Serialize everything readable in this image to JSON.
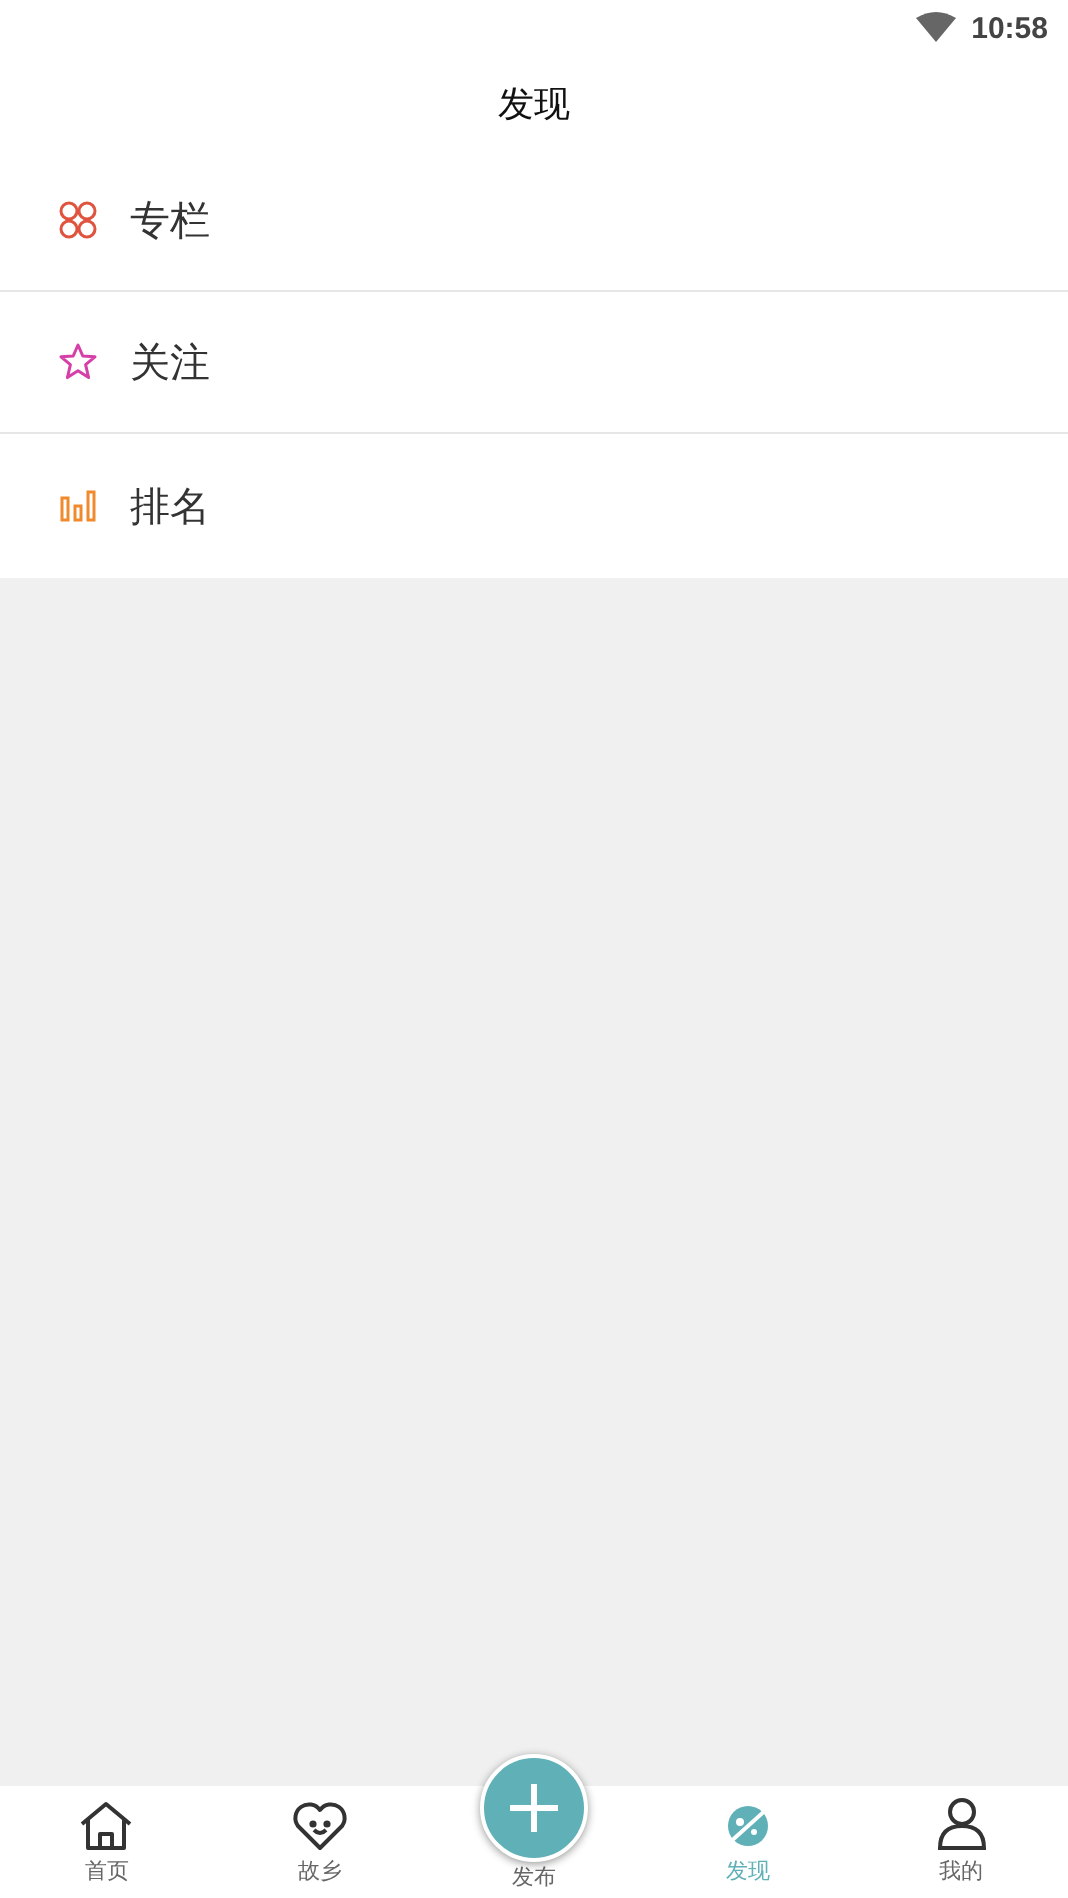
{
  "status_bar": {
    "time": "10:58"
  },
  "title": "发现",
  "menu": [
    {
      "kind": "columns",
      "label": "专栏"
    },
    {
      "kind": "follow",
      "label": "关注"
    },
    {
      "kind": "ranking",
      "label": "排名"
    }
  ],
  "tabs": [
    {
      "kind": "home",
      "label": "首页",
      "selected": false
    },
    {
      "kind": "hometown",
      "label": "故乡",
      "selected": false
    },
    {
      "kind": "publish",
      "label": "发布",
      "selected": false
    },
    {
      "kind": "discover",
      "label": "发现",
      "selected": true
    },
    {
      "kind": "mine",
      "label": "我的",
      "selected": false
    }
  ]
}
